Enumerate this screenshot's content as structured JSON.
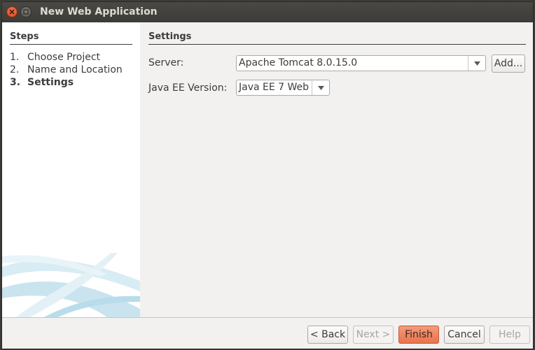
{
  "window": {
    "title": "New Web Application"
  },
  "steps": {
    "title": "Steps",
    "items": [
      {
        "num": "1.",
        "label": "Choose Project"
      },
      {
        "num": "2.",
        "label": "Name and Location"
      },
      {
        "num": "3.",
        "label": "Settings"
      }
    ]
  },
  "settings": {
    "title": "Settings",
    "server_label": "Server:",
    "server_value": "Apache Tomcat 8.0.15.0",
    "add_label": "Add...",
    "javaee_label": "Java EE Version:",
    "javaee_value": "Java EE 7 Web"
  },
  "footer": {
    "back_label": "< Back",
    "next_label": "Next >",
    "finish_label": "Finish",
    "cancel_label": "Cancel",
    "help_label": "Help"
  },
  "colors": {
    "accent": "#e9744d",
    "titlebar": "#3c3b37",
    "close": "#dd4814"
  }
}
